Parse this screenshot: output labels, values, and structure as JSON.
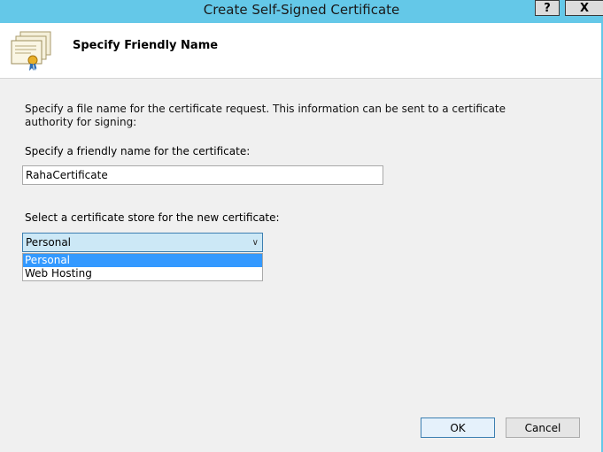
{
  "window": {
    "title": "Create Self-Signed Certificate",
    "help_label": "?",
    "close_label": "X"
  },
  "header": {
    "title": "Specify Friendly Name",
    "icon": "certificate-icon"
  },
  "body": {
    "description": "Specify a file name for the certificate request.  This information can be sent to a certificate authority for signing:",
    "friendly_label": "Specify a friendly name for the certificate:",
    "friendly_value": "RahaCertificate",
    "store_label": "Select a certificate store for the new certificate:",
    "store_selected": "Personal",
    "store_options": [
      "Personal",
      "Web Hosting"
    ]
  },
  "buttons": {
    "ok": "OK",
    "cancel": "Cancel"
  }
}
